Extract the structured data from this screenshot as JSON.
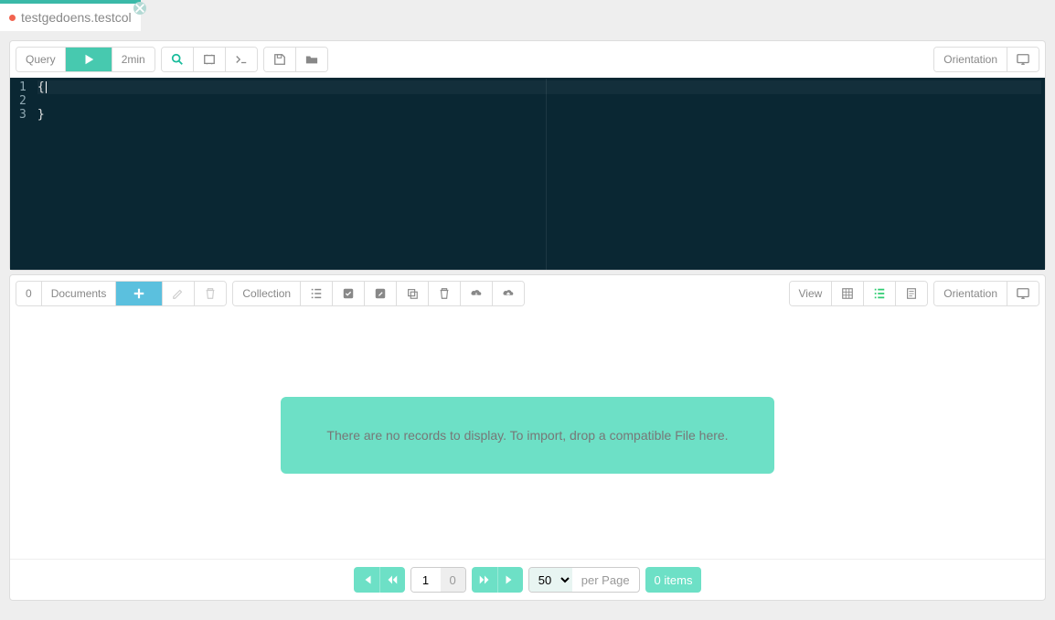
{
  "tab": {
    "title": "testgedoens.testcol",
    "modified": true
  },
  "query_toolbar": {
    "query_label": "Query",
    "timeout_label": "2min",
    "orientation_label": "Orientation"
  },
  "editor": {
    "lines": [
      "{",
      "",
      "}"
    ]
  },
  "docs_toolbar": {
    "count": "0",
    "documents_label": "Documents",
    "collection_label": "Collection",
    "view_label": "View",
    "orientation_label": "Orientation"
  },
  "results": {
    "empty_message": "There are no records to display. To import, drop a compatible File here."
  },
  "pager": {
    "current_page": "1",
    "total_pages": "0",
    "page_size": "50",
    "per_page_label": "per Page",
    "items_label": "0 items"
  }
}
